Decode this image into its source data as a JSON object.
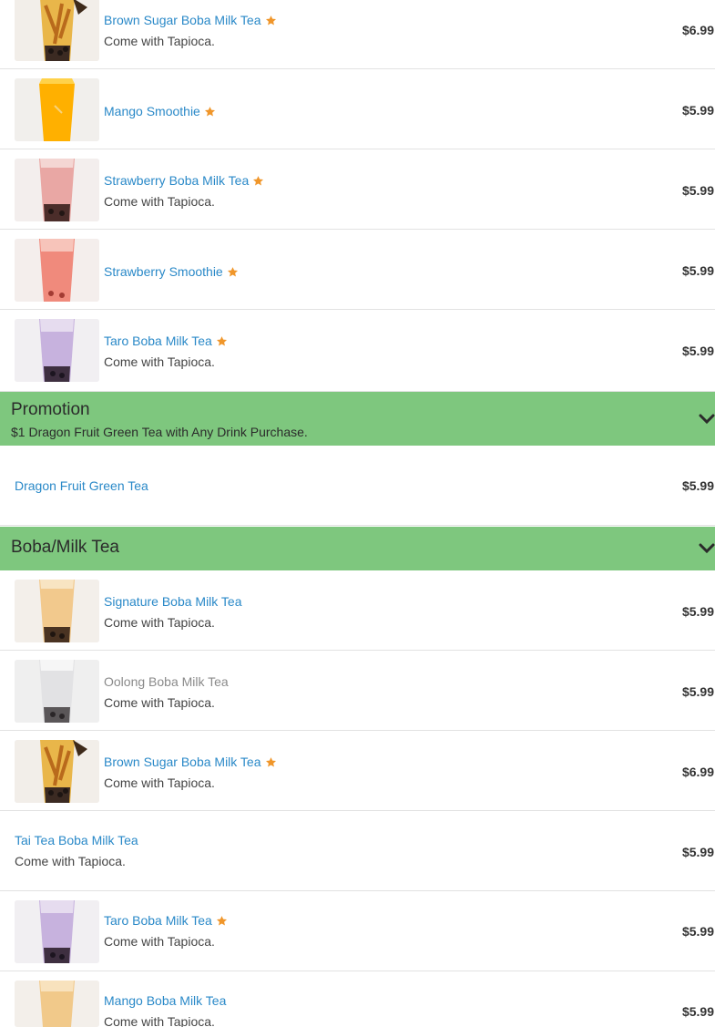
{
  "items_top": [
    {
      "name": "Brown Sugar Boba Milk Tea",
      "desc": "Come with Tapioca.",
      "price": "$6.99",
      "popular": true,
      "image": "brown-sugar"
    },
    {
      "name": "Mango Smoothie",
      "desc": "",
      "price": "$5.99",
      "popular": true,
      "image": "mango-smoothie"
    },
    {
      "name": "Strawberry Boba Milk Tea",
      "desc": "Come with Tapioca.",
      "price": "$5.99",
      "popular": true,
      "image": "strawberry-milk-tea"
    },
    {
      "name": "Strawberry Smoothie",
      "desc": "",
      "price": "$5.99",
      "popular": true,
      "image": "strawberry-smoothie"
    },
    {
      "name": "Taro Boba Milk Tea",
      "desc": "Come with Tapioca.",
      "price": "$5.99",
      "popular": true,
      "image": "taro"
    }
  ],
  "promotion": {
    "title": "Promotion",
    "subtitle": "$1 Dragon Fruit Green Tea with Any Drink Purchase.",
    "items": [
      {
        "name": "Dragon Fruit Green Tea",
        "price": "$5.99"
      }
    ]
  },
  "boba_section": {
    "title": "Boba/Milk Tea",
    "items": [
      {
        "name": "Signature Boba Milk Tea",
        "desc": "Come with Tapioca.",
        "price": "$5.99",
        "popular": false,
        "image": "signature"
      },
      {
        "name": "Oolong Boba Milk Tea",
        "desc": "Come with Tapioca.",
        "price": "$5.99",
        "popular": false,
        "image": "oolong"
      },
      {
        "name": "Brown Sugar Boba Milk Tea",
        "desc": "Come with Tapioca.",
        "price": "$6.99",
        "popular": true,
        "image": "brown-sugar"
      },
      {
        "name": "Tai Tea Boba Milk Tea",
        "desc": "Come with Tapioca.",
        "price": "$5.99",
        "popular": false,
        "image": ""
      },
      {
        "name": "Taro Boba Milk Tea",
        "desc": "Come with Tapioca.",
        "price": "$5.99",
        "popular": true,
        "image": "taro"
      },
      {
        "name": "Mango Boba Milk Tea",
        "desc": "Come with Tapioca.",
        "price": "$5.99",
        "popular": false,
        "image": "signature"
      }
    ]
  },
  "icons": {
    "popular": "star-icon",
    "expand": "chevron-down-icon"
  },
  "colors": {
    "accent_link": "#2a89c8",
    "section_bg": "#7ec77e",
    "star": "#f0962a",
    "muted_name": "#8a8a8a"
  }
}
